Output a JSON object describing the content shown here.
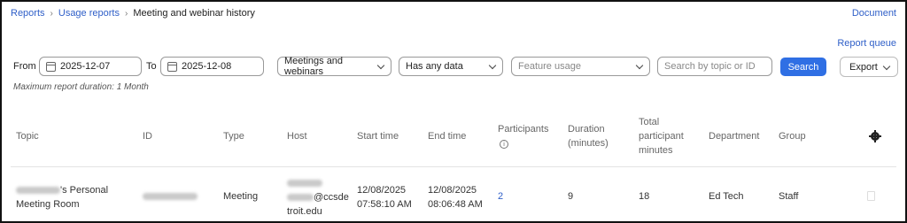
{
  "breadcrumb": {
    "items": [
      "Reports",
      "Usage reports"
    ],
    "current": "Meeting and webinar history",
    "separator": "›"
  },
  "header": {
    "document_link": "Document",
    "report_queue_link": "Report queue"
  },
  "filters": {
    "from_label": "From",
    "from_date": "2025-12-07",
    "to_label": "To",
    "to_date": "2025-12-08",
    "type_select": "Meetings and webinars",
    "data_select": "Has any data",
    "feature_placeholder": "Feature usage",
    "search_placeholder": "Search by topic or ID",
    "search_button": "Search",
    "export_button": "Export",
    "note": "Maximum report duration: 1 Month"
  },
  "table": {
    "headers": {
      "topic": "Topic",
      "id": "ID",
      "type": "Type",
      "host": "Host",
      "start": "Start time",
      "end": "End time",
      "participants": "Participants",
      "duration_1": "Duration",
      "duration_2": "(minutes)",
      "total_1": "Total",
      "total_2": "participant",
      "total_3": "minutes",
      "department": "Department",
      "group": "Group"
    },
    "rows": [
      {
        "topic_suffix": "'s Personal",
        "topic_line2": "Meeting Room",
        "type": "Meeting",
        "host_line2": "@ccsde",
        "host_line3": "troit.edu",
        "start_date": "12/08/2025",
        "start_time": "07:58:10 AM",
        "end_date": "12/08/2025",
        "end_time": "08:06:48 AM",
        "participants": "2",
        "duration": "9",
        "total_minutes": "18",
        "department": "Ed Tech",
        "group": "Staff"
      }
    ]
  },
  "colors": {
    "accent": "#2f6fe4",
    "link": "#2f5fc8"
  },
  "icons": [
    "calendar-icon",
    "chevron-down-icon",
    "info-icon",
    "gear-icon"
  ]
}
